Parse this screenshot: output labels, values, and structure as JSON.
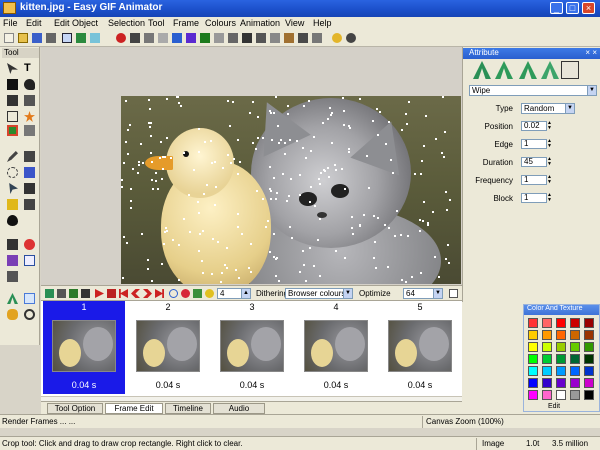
{
  "window": {
    "title": "kitten.jpg - Easy GIF Animator",
    "buttons": {
      "minimize": "_",
      "maximize": "□",
      "close": "×"
    }
  },
  "menu": [
    "File",
    "Edit",
    "Edit Object",
    "Selection",
    "Tool",
    "Frame",
    "Colours",
    "Animation",
    "View",
    "Help"
  ],
  "tool_panel": {
    "title": "Tool"
  },
  "attributes_panel": {
    "title": "Attribute",
    "close": "× ×",
    "effect_select": "Wipe",
    "fields": [
      {
        "label": "Type",
        "value": "Random"
      },
      {
        "label": "Position",
        "value": "0.02"
      },
      {
        "label": "Edge",
        "value": "1"
      },
      {
        "label": "Duration",
        "value": "45"
      },
      {
        "label": "Frequency",
        "value": "1"
      },
      {
        "label": "Block",
        "value": "1"
      }
    ]
  },
  "frame_toolbar": {
    "frame_number": "4",
    "dithering_label": "Dithering",
    "dithering_value": "Browser colours",
    "optimize_label": "Optimize",
    "optimize_value": "64"
  },
  "frames": [
    {
      "number": "1",
      "duration": "0.04 s",
      "selected": true
    },
    {
      "number": "2",
      "duration": "0.04 s",
      "selected": false
    },
    {
      "number": "3",
      "duration": "0.04 s",
      "selected": false
    },
    {
      "number": "4",
      "duration": "0.04 s",
      "selected": false
    },
    {
      "number": "5",
      "duration": "0.04 s",
      "selected": false
    }
  ],
  "tabs": [
    "Tool Option",
    "Frame Edit",
    "Timeline",
    "Audio"
  ],
  "color_panel": {
    "title": "Color And Texture",
    "edit_label": "Edit",
    "swatches": [
      "#ff3333",
      "#ff6666",
      "#ff0000",
      "#cc0000",
      "#990000",
      "#ffcc00",
      "#ff9900",
      "#ff6600",
      "#cc6600",
      "#993300",
      "#ffff00",
      "#ccff00",
      "#99cc00",
      "#66cc00",
      "#339900",
      "#00ff00",
      "#00cc33",
      "#009933",
      "#006633",
      "#003300",
      "#00ffff",
      "#00ccff",
      "#0099ff",
      "#0066ff",
      "#0033cc",
      "#0000ff",
      "#3300cc",
      "#6600cc",
      "#9900cc",
      "#cc00cc",
      "#ff00ff",
      "#ff66cc",
      "#ffffff",
      "#999999",
      "#000000"
    ]
  },
  "status": {
    "message": "Render Frames ... ...",
    "zoom": "Canvas Zoom (100%)",
    "hint": "Crop tool: Click and drag to draw crop rectangle. Right click to clear.",
    "image": "Image",
    "size": "1.0t",
    "memory": "3.5 million"
  },
  "colors": {
    "accent": "#1a1ae8",
    "titlebar": "#1b4fc9"
  }
}
